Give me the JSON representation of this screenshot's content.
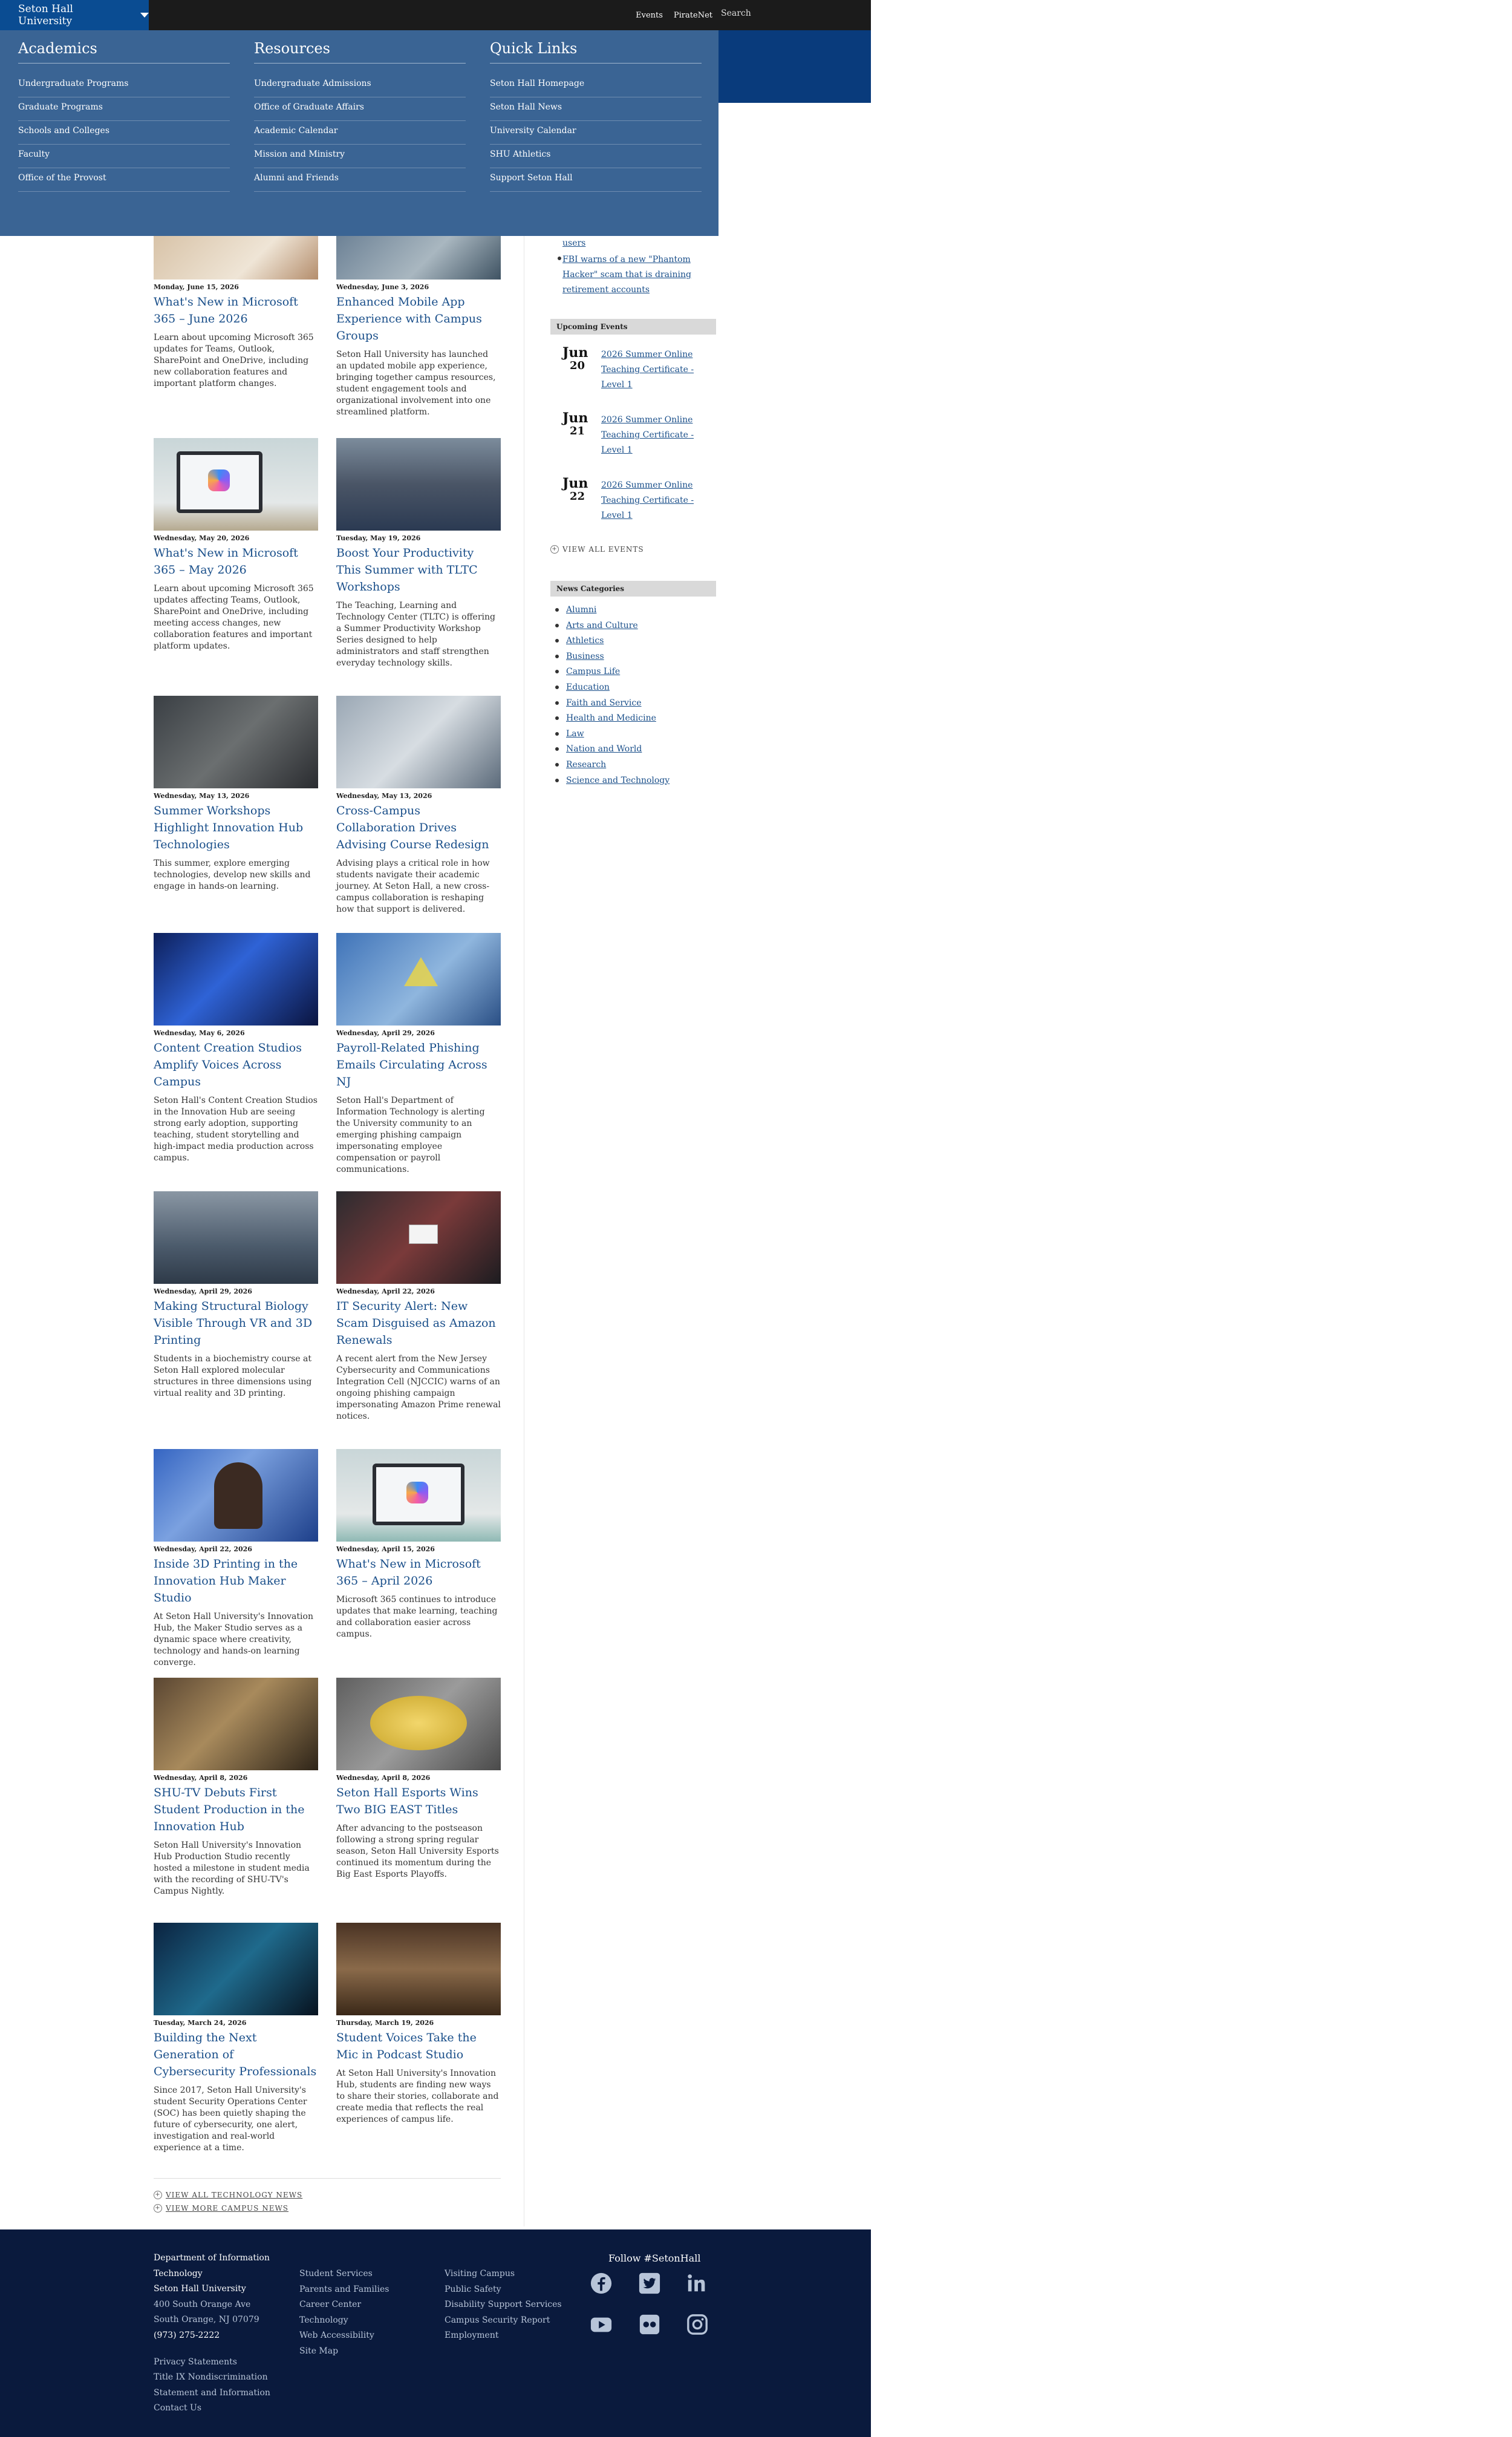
{
  "topbar": {
    "brand": "Seton Hall University",
    "links": [
      "Events",
      "PirateNet"
    ],
    "search_placeholder": "Search"
  },
  "mega_menu": {
    "columns": [
      {
        "heading": "Academics",
        "items": [
          "Undergraduate Programs",
          "Graduate Programs",
          "Schools and Colleges",
          "Faculty",
          "Office of the Provost"
        ]
      },
      {
        "heading": "Resources",
        "items": [
          "Undergraduate Admissions",
          "Office of Graduate Affairs",
          "Academic Calendar",
          "Mission and Ministry",
          "Alumni and Friends"
        ]
      },
      {
        "heading": "Quick Links",
        "items": [
          "Seton Hall Homepage",
          "Seton Hall News",
          "University Calendar",
          "SHU Athletics",
          "Support Seton Hall"
        ]
      }
    ]
  },
  "articles": [
    {
      "date": "Monday, June 15, 2026",
      "title": "What's New in Microsoft 365 – June 2026",
      "summary": "Learn about upcoming Microsoft 365 updates for Teams, Outlook, SharePoint and OneDrive, including new collaboration features and important platform changes."
    },
    {
      "date": "Wednesday, June 3, 2026",
      "title": "Enhanced Mobile App Experience with Campus Groups",
      "summary": "Seton Hall University has launched an updated mobile app experience, bringing together campus resources, student engagement tools and organizational involvement into one streamlined platform."
    },
    {
      "date": "Wednesday, May 20, 2026",
      "title": "What's New in Microsoft 365 – May 2026",
      "summary": "Learn about upcoming Microsoft 365 updates affecting Teams, Outlook, SharePoint and OneDrive, including meeting access changes, new collaboration features and important platform updates."
    },
    {
      "date": "Tuesday, May 19, 2026",
      "title": "Boost Your Productivity This Summer with TLTC Workshops",
      "summary": "The Teaching, Learning and Technology Center (TLTC) is offering a Summer Productivity Workshop Series designed to help administrators and staff strengthen everyday technology skills."
    },
    {
      "date": "Wednesday, May 13, 2026",
      "title": "Summer Workshops Highlight Innovation Hub Technologies",
      "summary": "This summer, explore emerging technologies, develop new skills and engage in hands-on learning."
    },
    {
      "date": "Wednesday, May 13, 2026",
      "title": "Cross-Campus Collaboration Drives Advising Course Redesign",
      "summary": "Advising plays a critical role in how students navigate their academic journey. At Seton Hall, a new cross-campus collaboration is reshaping how that support is delivered."
    },
    {
      "date": "Wednesday, May 6, 2026",
      "title": "Content Creation Studios Amplify Voices Across Campus",
      "summary": "Seton Hall's Content Creation Studios in the Innovation Hub are seeing strong early adoption, supporting teaching, student storytelling and high-impact media production across campus."
    },
    {
      "date": "Wednesday, April 29, 2026",
      "title": "Payroll-Related Phishing Emails Circulating Across NJ",
      "summary": "Seton Hall's Department of Information Technology is alerting the University community to an emerging phishing campaign impersonating employee compensation or payroll communications."
    },
    {
      "date": "Wednesday, April 29, 2026",
      "title": "Making Structural Biology Visible Through VR and 3D Printing",
      "summary": "Students in a biochemistry course at Seton Hall explored molecular structures in three dimensions using virtual reality and 3D printing."
    },
    {
      "date": "Wednesday, April 22, 2026",
      "title": "IT Security Alert: New Scam Disguised as Amazon Renewals",
      "summary": "A recent alert from the New Jersey Cybersecurity and Communications Integration Cell (NJCCIC) warns of an ongoing phishing campaign impersonating Amazon Prime renewal notices."
    },
    {
      "date": "Wednesday, April 22, 2026",
      "title": "Inside 3D Printing in the Innovation Hub Maker Studio",
      "summary": "At Seton Hall University's Innovation Hub, the Maker Studio serves as a dynamic space where creativity, technology and hands-on learning converge."
    },
    {
      "date": "Wednesday, April 15, 2026",
      "title": "What's New in Microsoft 365 – April 2026",
      "summary": "Microsoft 365 continues to introduce updates that make learning, teaching and collaboration easier across campus."
    },
    {
      "date": "Wednesday, April 8, 2026",
      "title": "SHU-TV Debuts First Student Production in the Innovation Hub",
      "summary": "Seton Hall University's Innovation Hub Production Studio recently hosted a milestone in student media with the recording of SHU-TV's Campus Nightly."
    },
    {
      "date": "Wednesday, April 8, 2026",
      "title": "Seton Hall Esports Wins Two BIG EAST Titles",
      "summary": "After advancing to the postseason following a strong spring regular season, Seton Hall University Esports continued its momentum during the Big East Esports Playoffs."
    },
    {
      "date": "Tuesday, March 24, 2026",
      "title": "Building the Next Generation of Cybersecurity Professionals",
      "summary": "Since 2017, Seton Hall University's student Security Operations Center (SOC) has been quietly shaping the future of cybersecurity, one alert, investigation and real-world experience at a time."
    },
    {
      "date": "Thursday, March 19, 2026",
      "title": "Student Voices Take the Mic in Podcast Studio",
      "summary": "At Seton Hall University's Innovation Hub, students are finding new ways to share their stories, collaborate and create media that reflects the real experiences of campus life."
    }
  ],
  "bottom_links": [
    "VIEW ALL TECHNOLOGY NEWS",
    "VIEW MORE CAMPUS NEWS"
  ],
  "sidebar": {
    "news_tail": [
      "users",
      "FBI warns of a new \"Phantom Hacker\" scam that is draining retirement accounts"
    ],
    "events_heading": "Upcoming Events",
    "events": [
      {
        "month": "Jun",
        "day": "20",
        "title": "2026 Summer Online Teaching Certificate - Level 1"
      },
      {
        "month": "Jun",
        "day": "21",
        "title": "2026 Summer Online Teaching Certificate - Level 1"
      },
      {
        "month": "Jun",
        "day": "22",
        "title": "2026 Summer Online Teaching Certificate - Level 1"
      }
    ],
    "view_all_events": "VIEW ALL EVENTS",
    "categories_heading": "News Categories",
    "categories": [
      "Alumni",
      "Arts and Culture",
      "Athletics",
      "Business",
      "Campus Life",
      "Education",
      "Faith and Service",
      "Health and Medicine",
      "Law",
      "Nation and World",
      "Research",
      "Science and Technology"
    ]
  },
  "footer": {
    "dept": "Department of Information Technology",
    "university": "Seton Hall University",
    "address1": "400 South Orange Ave",
    "address2": "South Orange, NJ 07079",
    "phone": "(973) 275-2222",
    "legal": [
      "Privacy Statements",
      "Title IX Nondiscrimination Statement and Information",
      "Contact Us"
    ],
    "col2": [
      "Student Services",
      "Parents and Families",
      "Career Center",
      "Technology",
      "Web Accessibility",
      "Site Map"
    ],
    "col3": [
      "Visiting Campus",
      "Public Safety",
      "Disability Support Services",
      "Campus Security Report",
      "Employment"
    ],
    "follow": "Follow #SetonHall",
    "social": [
      "facebook-icon",
      "twitter-icon",
      "linkedin-icon",
      "youtube-icon",
      "flickr-icon",
      "instagram-icon"
    ]
  }
}
